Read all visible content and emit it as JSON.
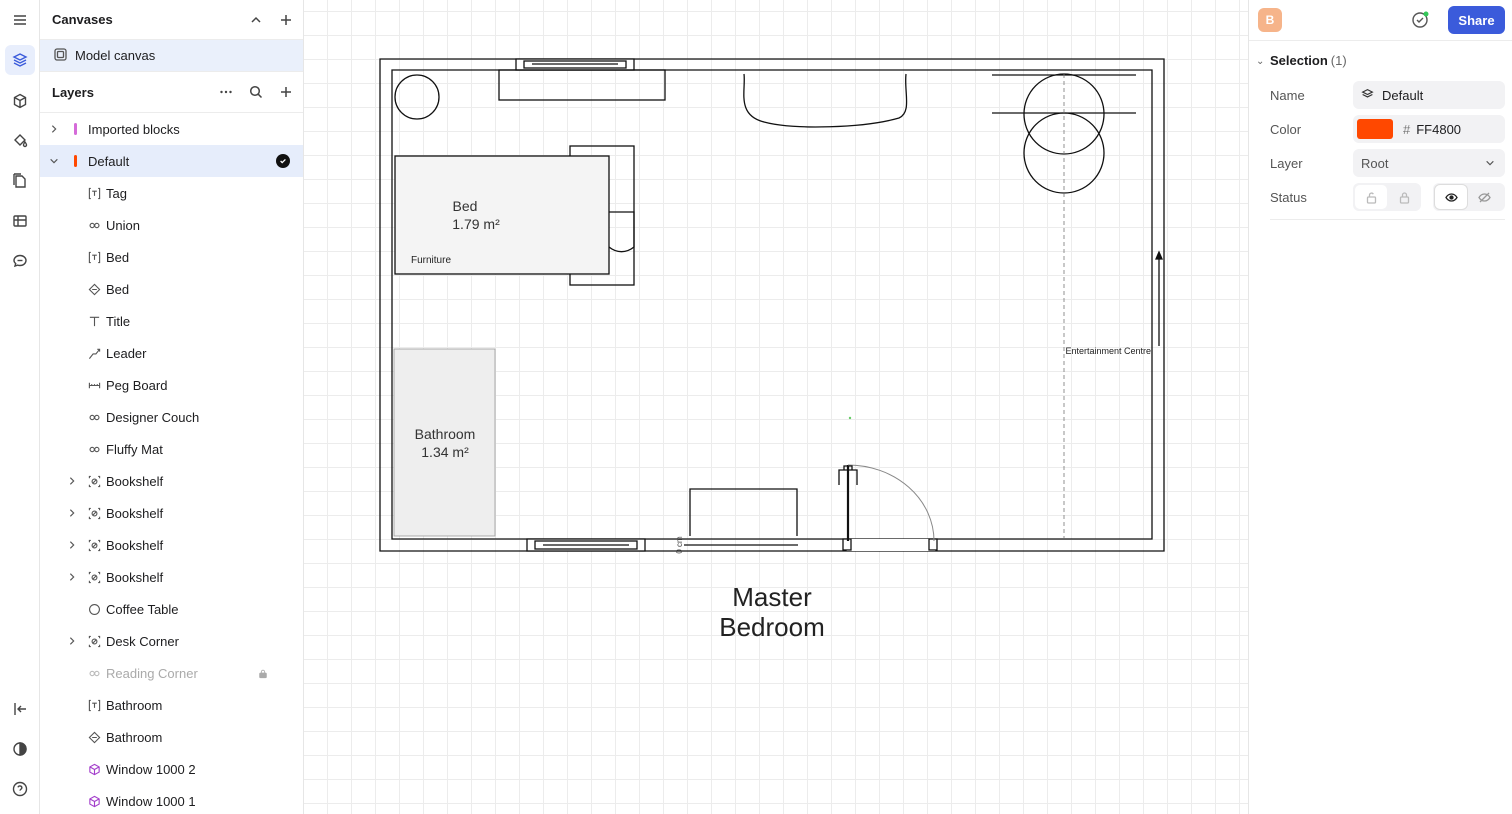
{
  "rail": {
    "icons": [
      "menu-icon",
      "layers-icon",
      "cube-icon",
      "paint-bucket-icon",
      "pages-icon",
      "table-icon",
      "comment-icon",
      "collapse-panel-icon",
      "contrast-icon",
      "help-icon"
    ]
  },
  "canvases": {
    "title": "Canvases",
    "items": [
      {
        "label": "Model canvas"
      }
    ]
  },
  "layers": {
    "title": "Layers",
    "items": [
      {
        "label": "Imported blocks",
        "icon": "layer-bar-icon",
        "bar_color": "#d56bd9",
        "expandable": true,
        "depth": 0
      },
      {
        "label": "Default",
        "icon": "layer-bar-icon",
        "bar_color": "#ff4800",
        "expandable": true,
        "expanded": true,
        "selected": true,
        "depth": 0
      },
      {
        "label": "Tag",
        "icon": "tag-icon",
        "depth": 1
      },
      {
        "label": "Union",
        "icon": "union-icon",
        "depth": 1
      },
      {
        "label": "Bed",
        "icon": "tag-icon",
        "depth": 1
      },
      {
        "label": "Bed",
        "icon": "area-icon",
        "depth": 1
      },
      {
        "label": "Title",
        "icon": "text-icon",
        "depth": 1
      },
      {
        "label": "Leader",
        "icon": "leader-icon",
        "depth": 1
      },
      {
        "label": "Peg Board",
        "icon": "dimension-icon",
        "depth": 1
      },
      {
        "label": "Designer Couch",
        "icon": "union-icon",
        "depth": 1
      },
      {
        "label": "Fluffy Mat",
        "icon": "union-icon",
        "depth": 1
      },
      {
        "label": "Bookshelf",
        "icon": "block-icon",
        "depth": 1,
        "expandable": true
      },
      {
        "label": "Bookshelf",
        "icon": "block-icon",
        "depth": 1,
        "expandable": true
      },
      {
        "label": "Bookshelf",
        "icon": "block-icon",
        "depth": 1,
        "expandable": true
      },
      {
        "label": "Bookshelf",
        "icon": "block-icon",
        "depth": 1,
        "expandable": true
      },
      {
        "label": "Coffee Table",
        "icon": "circle-icon",
        "depth": 1
      },
      {
        "label": "Desk Corner",
        "icon": "block-icon",
        "depth": 1,
        "expandable": true
      },
      {
        "label": "Reading Corner",
        "icon": "union-icon",
        "depth": 1,
        "locked": true
      },
      {
        "label": "Bathroom",
        "icon": "tag-icon",
        "depth": 1
      },
      {
        "label": "Bathroom",
        "icon": "area-icon",
        "depth": 1
      },
      {
        "label": "Window 1000 2",
        "icon": "window-cube-icon",
        "depth": 1
      },
      {
        "label": "Window 1000 1",
        "icon": "window-cube-icon",
        "depth": 1
      }
    ]
  },
  "plan": {
    "rooms": [
      {
        "name": "Bed",
        "area": "1.79 m²",
        "tag": "Furniture"
      },
      {
        "name": "Bathroom",
        "area": "1.34 m²"
      }
    ],
    "entertainment_label": "Entertainment Centre",
    "dimension_label": "0 cm",
    "title_line1": "Master",
    "title_line2": "Bedroom"
  },
  "inspector": {
    "avatar_letter": "B",
    "share_label": "Share",
    "section_title": "Selection",
    "section_count": "(1)",
    "name_label": "Name",
    "name_value": "Default",
    "color_label": "Color",
    "color_hash": "#",
    "color_value": "FF4800",
    "color_hex": "#ff4800",
    "layer_label": "Layer",
    "layer_value": "Root",
    "status_label": "Status"
  }
}
